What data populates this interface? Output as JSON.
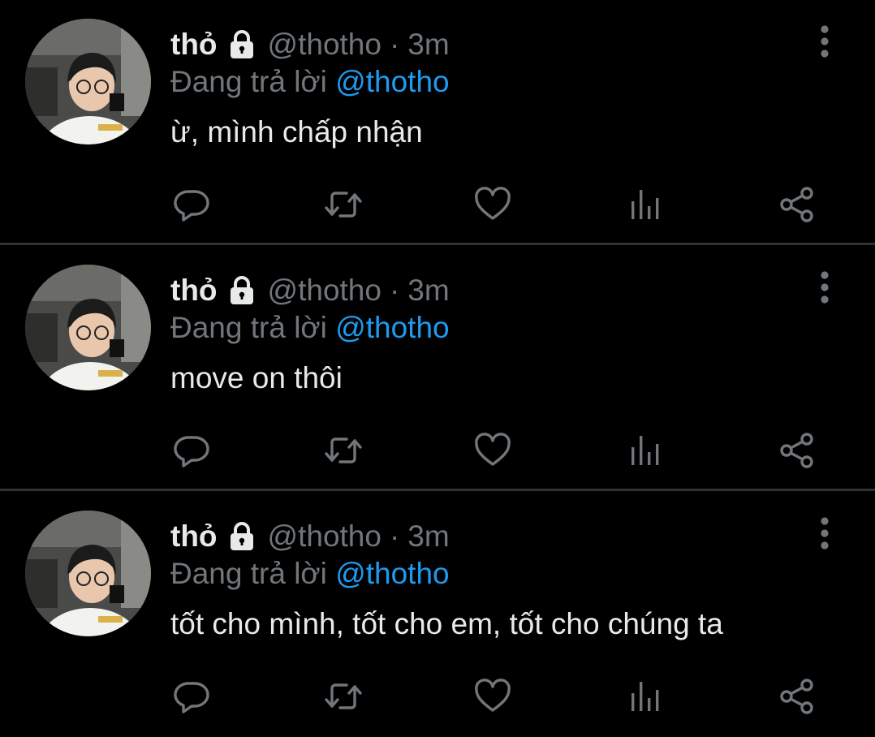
{
  "colors": {
    "background": "#000000",
    "primary_text": "#e7e9ea",
    "secondary_text": "#71767b",
    "accent": "#1d9bf0",
    "divider": "#2f3336",
    "icon": "#71767b"
  },
  "icons": {
    "lock": "lock-icon",
    "more": "more-vertical-icon",
    "reply": "reply-icon",
    "retweet": "retweet-icon",
    "like": "heart-icon",
    "analytics": "analytics-icon",
    "share": "share-icon"
  },
  "tweets": [
    {
      "display_name": "thỏ",
      "handle": "@thotho",
      "separator": "·",
      "time": "3m",
      "reply_prefix": "Đang trả lời",
      "reply_to": "@thotho",
      "text": "ừ, mình chấp nhận"
    },
    {
      "display_name": "thỏ",
      "handle": "@thotho",
      "separator": "·",
      "time": "3m",
      "reply_prefix": "Đang trả lời",
      "reply_to": "@thotho",
      "text": "move on thôi"
    },
    {
      "display_name": "thỏ",
      "handle": "@thotho",
      "separator": "·",
      "time": "3m",
      "reply_prefix": "Đang trả lời",
      "reply_to": "@thotho",
      "text": "tốt cho mình, tốt cho em, tốt cho chúng ta"
    }
  ]
}
